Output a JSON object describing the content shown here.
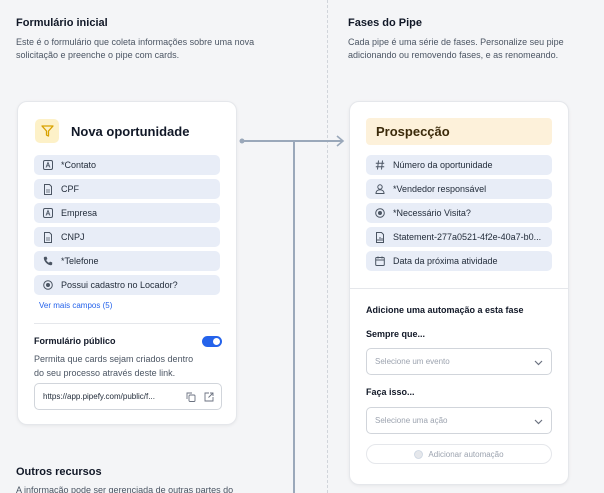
{
  "left_section": {
    "title": "Formulário inicial",
    "desc_line1": "Este é o formulário que coleta informações sobre uma nova",
    "desc_line2": "solicitação e preenche o pipe com cards."
  },
  "right_section": {
    "title": "Fases do Pipe",
    "desc_line1": "Cada pipe é uma série de fases. Personalize seu pipe",
    "desc_line2": "adicionando ou removendo fases, e as renomeando."
  },
  "start_form": {
    "title": "Nova oportunidade",
    "fields": [
      {
        "label": "*Contato",
        "icon": "text-field-icon"
      },
      {
        "label": "CPF",
        "icon": "document-icon"
      },
      {
        "label": "Empresa",
        "icon": "text-field-icon"
      },
      {
        "label": "CNPJ",
        "icon": "document-icon"
      },
      {
        "label": "*Telefone",
        "icon": "phone-icon"
      },
      {
        "label": "Possui cadastro no Locador?",
        "icon": "radio-icon"
      }
    ],
    "more_fields": "Ver mais campos (5)",
    "public_form_label": "Formulário público",
    "public_form_enabled": true,
    "public_desc_line1": "Permita que cards sejam criados dentro",
    "public_desc_line2": "do seu processo através deste link.",
    "public_url": "https://app.pipefy.com/public/f..."
  },
  "phase": {
    "title": "Prospecção",
    "fields": [
      {
        "label": "Número da oportunidade",
        "icon": "hash-icon"
      },
      {
        "label": "*Vendedor responsável",
        "icon": "user-icon"
      },
      {
        "label": "*Necessário Visita?",
        "icon": "radio-icon"
      },
      {
        "label": "Statement-277a0521-4f2e-40a7-b0...",
        "icon": "formula-icon"
      },
      {
        "label": "Data da próxima atividade",
        "icon": "calendar-icon"
      }
    ],
    "automation_title": "Adicione uma automação a esta fase",
    "when_label": "Sempre que...",
    "when_placeholder": "Selecione um evento",
    "do_label": "Faça isso...",
    "do_placeholder": "Selecione uma ação",
    "add_button": "Adicionar automação"
  },
  "other_resources": {
    "title": "Outros recursos",
    "desc_line1": "A informação pode ser gerenciada de outras partes do"
  }
}
